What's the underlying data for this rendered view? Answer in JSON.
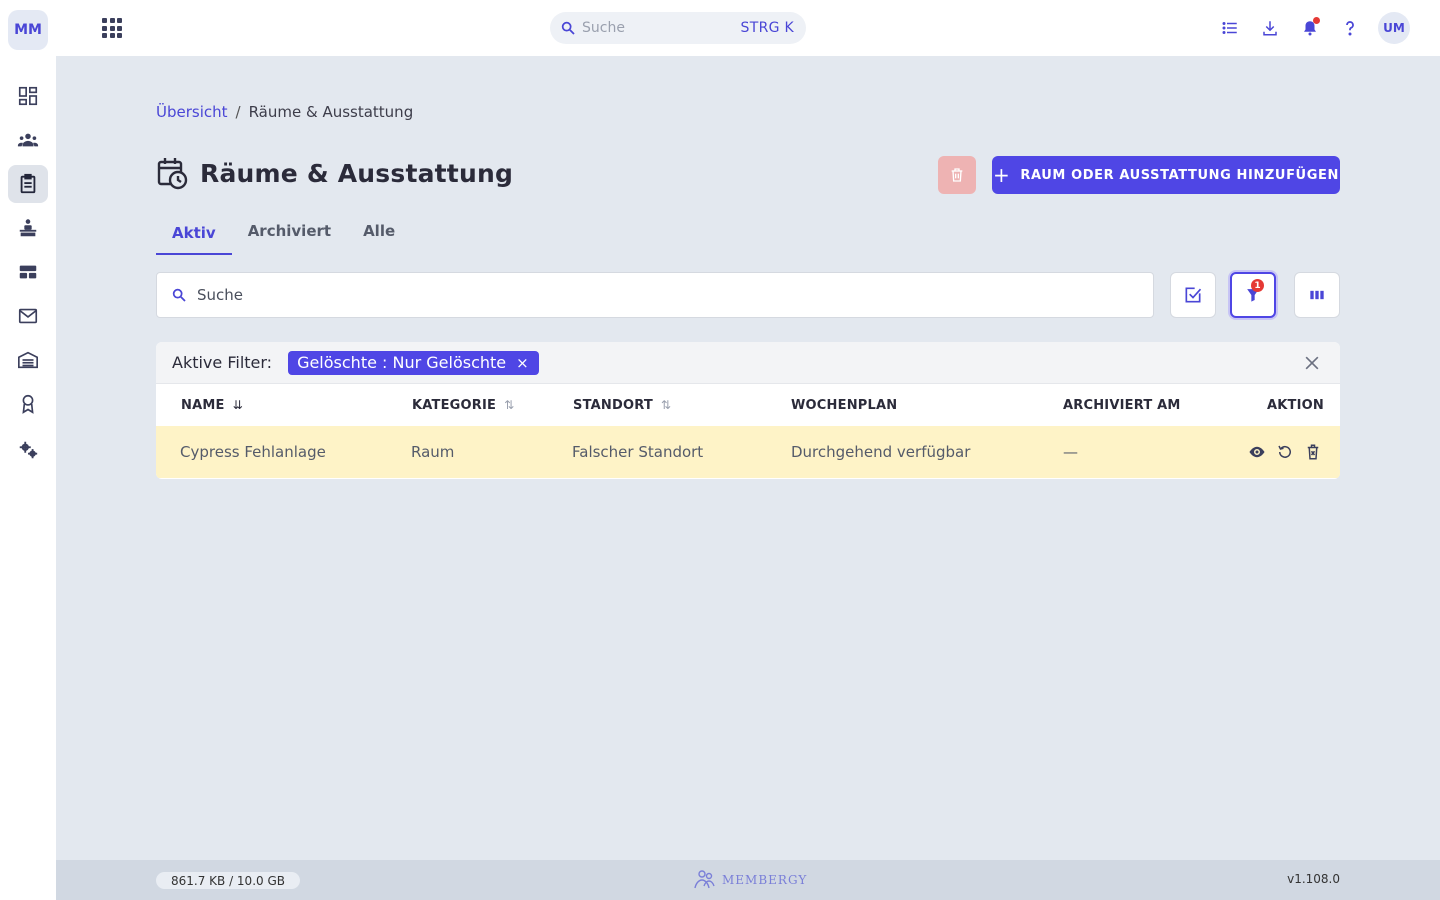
{
  "sidebar": {
    "logo": "MM",
    "items": [
      {
        "name": "dashboard"
      },
      {
        "name": "members"
      },
      {
        "name": "rooms"
      },
      {
        "name": "courses"
      },
      {
        "name": "layout"
      },
      {
        "name": "mail"
      },
      {
        "name": "buildings"
      },
      {
        "name": "awards"
      },
      {
        "name": "settings"
      }
    ]
  },
  "topbar": {
    "search_placeholder": "Suche",
    "search_shortcut": "STRG K",
    "avatar": "UM"
  },
  "breadcrumb": {
    "parent": "Übersicht",
    "separator": "/",
    "current": "Räume & Ausstattung"
  },
  "page": {
    "title": "Räume & Ausstattung",
    "add_button": "RAUM ODER AUSSTATTUNG HINZUFÜGEN",
    "add_plus": "+"
  },
  "tabs": [
    {
      "label": "Aktiv",
      "active": true
    },
    {
      "label": "Archiviert",
      "active": false
    },
    {
      "label": "Alle",
      "active": false
    }
  ],
  "search": {
    "placeholder": "Suche",
    "filter_badge": "1"
  },
  "filters": {
    "label": "Aktive Filter:",
    "chip": "Gelöschte : Nur Gelöschte",
    "chip_close": "×"
  },
  "table": {
    "headers": {
      "name": "NAME",
      "kategorie": "KATEGORIE",
      "standort": "STANDORT",
      "wochenplan": "WOCHENPLAN",
      "archiviert": "ARCHIVIERT AM",
      "aktion": "AKTION"
    },
    "rows": [
      {
        "name": "Cypress Fehlanlage",
        "kategorie": "Raum",
        "standort": "Falscher Standort",
        "wochenplan": "Durchgehend verfügbar",
        "archiviert": "—"
      }
    ]
  },
  "footer": {
    "storage": "861.7 KB / 10.0 GB",
    "brand": "MEMBERGY",
    "version": "v1.108.0"
  },
  "colors": {
    "primary": "#4f46e5",
    "danger_disabled": "#eeb3b3",
    "row_highlight": "#fef3c7",
    "badge": "#e53935"
  }
}
